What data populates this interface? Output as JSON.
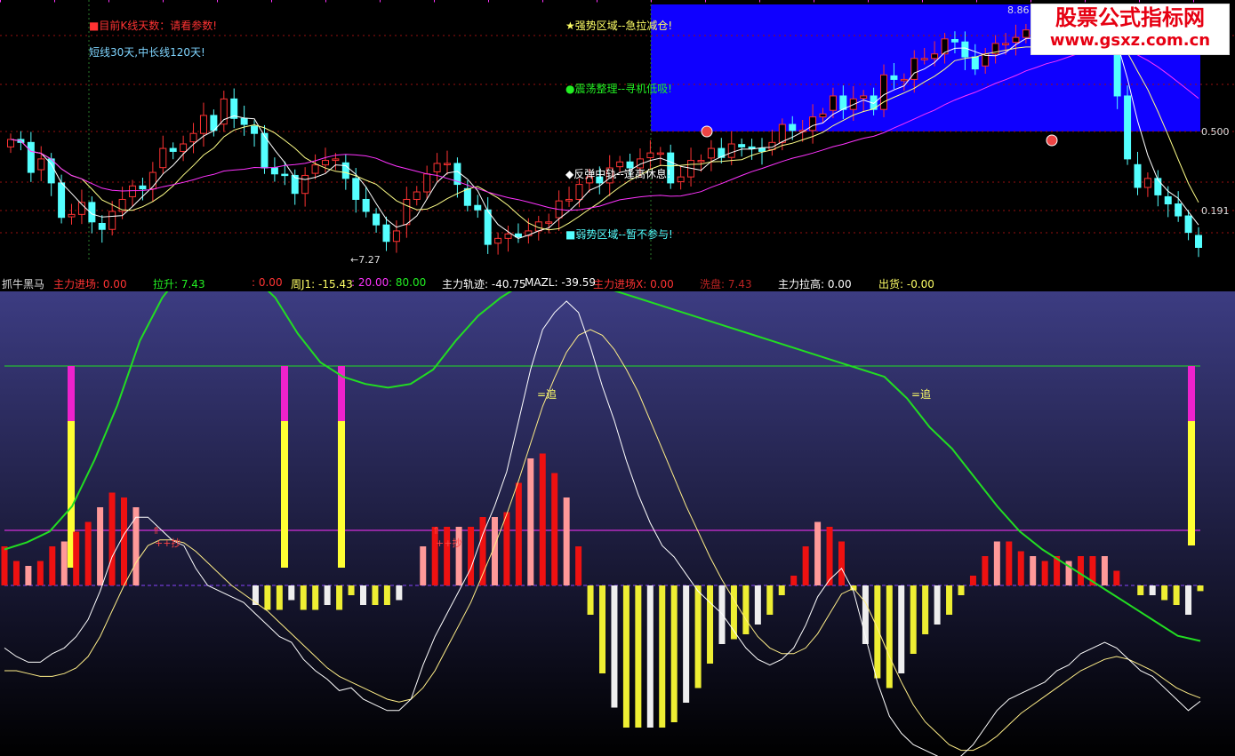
{
  "top_panel": {
    "info1": "■目前K线天数：请看参数!",
    "info2": "短线30天,中长线120天!",
    "zone_strong": "★强势区域--急拉减仓!",
    "zone_shock": "●震荡整理--寻机低吸!",
    "zone_rebound": "◆反弹中轨--逢高休息!",
    "zone_weak": "■弱势区域--暂不参与!",
    "low_marker": "←7.27",
    "high_marker": "8.86",
    "level_high": "0.500",
    "level_low": "0.191"
  },
  "brand": {
    "title": "股票公式指标网",
    "url": "www.gsxz.com.cn"
  },
  "status_bar": {
    "name": "抓牛黑马",
    "f1": "主力进场: 0.00",
    "f2": "拉升: 7.43",
    "f3": ": 0.00",
    "f4": "周J1: -15.43",
    "f5": ": 20.00",
    "f6": ": 80.00",
    "f7": "主力轨迹: -40.75",
    "f8": "MAZL: -39.59",
    "f9": "主力进场X: 0.00",
    "f10": "洗盘: 7.43",
    "f11": "主力拉高: 0.00",
    "f12": "出货: -0.00"
  },
  "bottom_labels": {
    "chase": "=追",
    "buy": "++抄"
  },
  "colors": {
    "up_candle": "#ff3333",
    "down_candle": "#54ffff",
    "ma_short": "#ffffff",
    "ma_mid": "#ffff88",
    "ma_long": "#ff33ff",
    "strong_zone": "#0f00ff",
    "green_line": "#22dd22",
    "pos_bar": "#ee1111",
    "neg_bar_yellow": "#eeee33",
    "neg_bar_white": "#eeeeee"
  },
  "chart_data": [
    {
      "type": "candlestick",
      "title": "",
      "close": [
        8.0,
        7.98,
        7.78,
        7.87,
        7.71,
        7.48,
        7.5,
        7.58,
        7.45,
        7.4,
        7.52,
        7.6,
        7.69,
        7.67,
        7.78,
        7.94,
        7.92,
        7.97,
        8.04,
        8.16,
        8.06,
        8.27,
        8.14,
        8.1,
        8.04,
        7.81,
        7.77,
        7.76,
        7.64,
        7.76,
        7.83,
        7.86,
        7.87,
        7.74,
        7.6,
        7.52,
        7.43,
        7.32,
        7.39,
        7.6,
        7.65,
        7.77,
        7.84,
        7.84,
        7.7,
        7.56,
        7.53,
        7.3,
        7.34,
        7.37,
        7.35,
        7.39,
        7.45,
        7.45,
        7.59,
        7.6,
        7.7,
        7.75,
        7.71,
        7.81,
        7.85,
        7.81,
        7.87,
        7.91,
        7.91,
        7.71,
        7.75,
        7.86,
        7.86,
        7.94,
        7.88,
        7.97,
        7.95,
        7.94,
        7.92,
        7.98,
        8.1,
        8.06,
        8.06,
        8.15,
        8.17,
        8.29,
        8.2,
        8.27,
        8.29,
        8.2,
        8.43,
        8.4,
        8.4,
        8.54,
        8.54,
        8.57,
        8.67,
        8.65,
        8.55,
        8.47,
        8.57,
        8.64,
        8.64,
        8.68,
        8.73,
        8.65,
        8.71,
        8.68,
        8.71,
        8.8,
        8.82,
        8.81,
        8.65,
        8.29,
        7.87,
        7.68,
        7.74,
        7.63,
        7.57,
        7.49,
        7.38,
        7.28
      ],
      "volume_like_note": "",
      "moving_averages": [
        "short",
        "mid",
        "long"
      ],
      "levels": [
        0.5,
        0.191
      ],
      "annotations": [
        "←7.27",
        "8.86"
      ]
    },
    {
      "type": "line",
      "title": "抓牛黑马",
      "series": [
        {
          "name": "主力轨迹",
          "values": [
            -22,
            -25,
            -27,
            -27,
            -24,
            -22,
            -18,
            -12,
            -2,
            10,
            18,
            24,
            24,
            20,
            16,
            14,
            6,
            0,
            -2,
            -4,
            -6,
            -10,
            -14,
            -18,
            -20,
            -26,
            -30,
            -33,
            -37,
            -36,
            -40,
            -42,
            -44,
            -44,
            -40,
            -28,
            -18,
            -10,
            -2,
            6,
            18,
            28,
            40,
            58,
            76,
            90,
            96,
            100,
            96,
            84,
            70,
            58,
            44,
            32,
            22,
            14,
            10,
            4,
            -2,
            -6,
            -10,
            -16,
            -22,
            -26,
            -28,
            -26,
            -22,
            -14,
            -4,
            2,
            6,
            -2,
            -18,
            -34,
            -46,
            -52,
            -56,
            -58,
            -60,
            -62,
            -60,
            -56,
            -50,
            -44,
            -40,
            -38,
            -36,
            -34,
            -30,
            -28,
            -24,
            -22,
            -20,
            -22,
            -26,
            -30,
            -32,
            -36,
            -40,
            -44,
            -40.75
          ]
        },
        {
          "name": "MAZL",
          "values": [
            -30,
            -30,
            -31,
            -32,
            -32,
            -31,
            -29,
            -25,
            -18,
            -9,
            0,
            8,
            14,
            16,
            16,
            15,
            12,
            8,
            4,
            0,
            -3,
            -6,
            -9,
            -13,
            -17,
            -21,
            -25,
            -29,
            -32,
            -34,
            -36,
            -38,
            -40,
            -41,
            -40,
            -36,
            -30,
            -22,
            -14,
            -6,
            4,
            14,
            25,
            37,
            50,
            63,
            73,
            82,
            88,
            90,
            88,
            83,
            76,
            68,
            58,
            48,
            38,
            28,
            19,
            10,
            2,
            -5,
            -12,
            -18,
            -22,
            -24,
            -24,
            -22,
            -17,
            -10,
            -3,
            -1,
            -6,
            -15,
            -25,
            -34,
            -42,
            -48,
            -52,
            -56,
            -58,
            -58,
            -56,
            -53,
            -49,
            -45,
            -42,
            -39,
            -36,
            -33,
            -30,
            -28,
            -26,
            -25,
            -26,
            -28,
            -30,
            -33,
            -36,
            -38,
            -39.59
          ]
        },
        {
          "name": "周J1",
          "values": [
            10,
            12,
            15,
            22,
            35,
            50,
            68,
            80,
            88,
            92,
            92,
            86,
            80,
            70,
            62,
            58,
            56,
            55,
            56,
            60,
            68,
            75,
            80,
            84,
            85,
            84,
            83,
            82,
            80,
            78,
            76,
            74,
            72,
            70,
            68,
            66,
            64,
            62,
            60,
            58,
            52,
            44,
            38,
            30,
            22,
            15,
            10,
            6,
            2,
            -2,
            -6,
            -10,
            -14,
            -15.43
          ]
        },
        {
          "name": "主力进场",
          "values": [
            0
          ]
        },
        {
          "name": "拉升",
          "values": [
            7.43
          ]
        },
        {
          "name": "洗盘",
          "values": [
            7.43
          ]
        },
        {
          "name": "主力拉高",
          "values": [
            0
          ]
        },
        {
          "name": "出货",
          "values": [
            0
          ]
        }
      ],
      "reference_lines": [
        20,
        80
      ]
    }
  ]
}
